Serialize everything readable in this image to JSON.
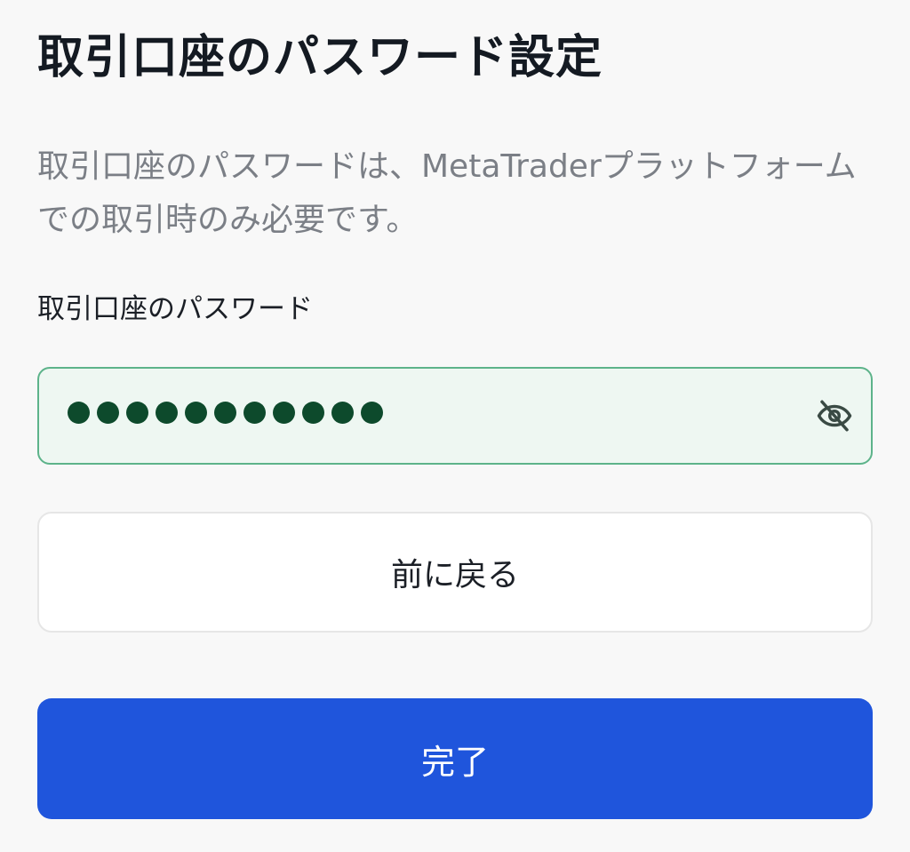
{
  "header": {
    "title": "取引口座のパスワード設定"
  },
  "content": {
    "description": "取引口座のパスワードは、MetaTraderプラットフォームでの取引時のみ必要です。"
  },
  "form": {
    "password_label": "取引口座のパスワード",
    "password_masked": "●●●●●●●●●●●",
    "password_length": 11,
    "visibility_icon": "eye-off-icon"
  },
  "actions": {
    "back_label": "前に戻る",
    "done_label": "完了"
  },
  "colors": {
    "primary": "#1f55dc",
    "input_border": "#5db38a",
    "input_background": "#eef7f2",
    "dot": "#0d4a2c"
  }
}
